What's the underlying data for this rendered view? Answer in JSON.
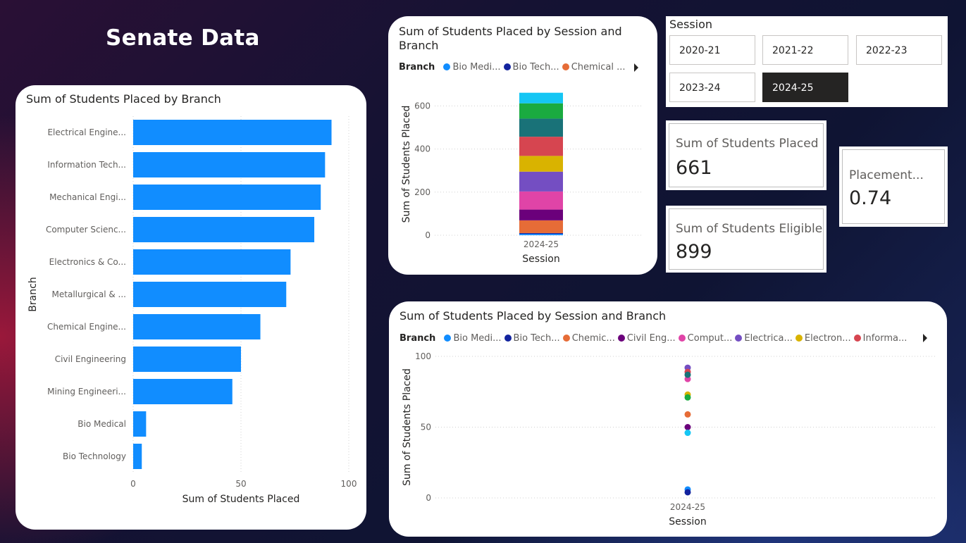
{
  "page": {
    "title": "Senate Data"
  },
  "colors": {
    "bar": "#118dff",
    "branches": {
      "Bio Medical": "#118dff",
      "Bio Technology": "#12239e",
      "Chemical Engineering": "#e66c37",
      "Civil Engineering": "#6b007b",
      "Computer Science": "#e044a7",
      "Electrical Engineering": "#744ec2",
      "Electronics": "#d9b300",
      "Information Technology": "#d64550",
      "Metallurgical": "#197278",
      "Mechanical Engineering": "#1aab40",
      "Mining Engineering": "#15c6f4"
    }
  },
  "bar_chart": {
    "title": "Sum of Students Placed by Branch",
    "xlabel": "Sum of Students Placed",
    "ylabel": "Branch"
  },
  "stacked_chart": {
    "title": "Sum of Students Placed by Session and Branch",
    "legend_title": "Branch",
    "legend_items": [
      "Bio Medi...",
      "Bio Tech...",
      "Chemical ..."
    ],
    "legend_colors": [
      "#118dff",
      "#12239e",
      "#e66c37"
    ],
    "xlabel": "Session",
    "ylabel": "Sum of Students Placed"
  },
  "scatter_chart": {
    "title": "Sum of Students Placed by Session and Branch",
    "legend_title": "Branch",
    "legend_items": [
      "Bio Medi...",
      "Bio Tech...",
      "Chemic...",
      "Civil Eng...",
      "Comput...",
      "Electrica...",
      "Electron...",
      "Informa..."
    ],
    "legend_colors": [
      "#118dff",
      "#12239e",
      "#e66c37",
      "#6b007b",
      "#e044a7",
      "#744ec2",
      "#d9b300",
      "#d64550"
    ],
    "xlabel": "Session",
    "ylabel": "Sum of Students Placed"
  },
  "slicer": {
    "title": "Session",
    "options": [
      "2020-21",
      "2021-22",
      "2022-23",
      "2023-24",
      "2024-25"
    ],
    "selected": "2024-25"
  },
  "kpis": {
    "placed": {
      "label": "Sum of Students Placed",
      "value": "661"
    },
    "eligible": {
      "label": "Sum of Students Eligible",
      "value": "899"
    },
    "rate": {
      "label": "Placement...",
      "value": "0.74"
    }
  },
  "chart_data": [
    {
      "type": "bar",
      "orientation": "horizontal",
      "title": "Sum of Students Placed by Branch",
      "xlabel": "Sum of Students Placed",
      "ylabel": "Branch",
      "categories": [
        "Electrical Engine...",
        "Information Tech...",
        "Mechanical Engi...",
        "Computer Scienc...",
        "Electronics & Co...",
        "Metallurgical & ...",
        "Chemical Engine...",
        "Civil Engineering",
        "Mining Engineeri...",
        "Bio Medical",
        "Bio Technology"
      ],
      "values": [
        92,
        89,
        87,
        84,
        73,
        71,
        59,
        50,
        46,
        6,
        4
      ],
      "xlim": [
        0,
        100
      ],
      "xticks": [
        0,
        50,
        100
      ],
      "grid": true
    },
    {
      "type": "bar",
      "stacked": true,
      "title": "Sum of Students Placed by Session and Branch",
      "xlabel": "Session",
      "ylabel": "Sum of Students Placed",
      "categories": [
        "2024-25"
      ],
      "series": [
        {
          "name": "Bio Medical",
          "values": [
            6
          ]
        },
        {
          "name": "Bio Technology",
          "values": [
            4
          ]
        },
        {
          "name": "Chemical Engineering",
          "values": [
            59
          ]
        },
        {
          "name": "Civil Engineering",
          "values": [
            50
          ]
        },
        {
          "name": "Computer Science",
          "values": [
            84
          ]
        },
        {
          "name": "Electrical Engineering",
          "values": [
            92
          ]
        },
        {
          "name": "Electronics",
          "values": [
            73
          ]
        },
        {
          "name": "Information Technology",
          "values": [
            89
          ]
        },
        {
          "name": "Metallurgical",
          "values": [
            84
          ]
        },
        {
          "name": "Mechanical Engineering",
          "values": [
            71
          ]
        },
        {
          "name": "Mining Engineering",
          "values": [
            49
          ]
        }
      ],
      "ylim": [
        0,
        660
      ],
      "yticks": [
        0,
        200,
        400,
        600
      ],
      "grid": true
    },
    {
      "type": "scatter",
      "title": "Sum of Students Placed by Session and Branch",
      "xlabel": "Session",
      "ylabel": "Sum of Students Placed",
      "categories": [
        "2024-25"
      ],
      "series": [
        {
          "name": "Bio Medical",
          "values": [
            6
          ]
        },
        {
          "name": "Bio Technology",
          "values": [
            4
          ]
        },
        {
          "name": "Chemical Engineering",
          "values": [
            59
          ]
        },
        {
          "name": "Civil Engineering",
          "values": [
            50
          ]
        },
        {
          "name": "Computer Science",
          "values": [
            84
          ]
        },
        {
          "name": "Electrical Engineering",
          "values": [
            92
          ]
        },
        {
          "name": "Electronics",
          "values": [
            73
          ]
        },
        {
          "name": "Information Technology",
          "values": [
            89
          ]
        },
        {
          "name": "Metallurgical",
          "values": [
            87
          ]
        },
        {
          "name": "Mechanical Engineering",
          "values": [
            71
          ]
        },
        {
          "name": "Mining Engineering",
          "values": [
            46
          ]
        }
      ],
      "ylim": [
        0,
        100
      ],
      "yticks": [
        0,
        50,
        100
      ],
      "grid": true
    }
  ]
}
